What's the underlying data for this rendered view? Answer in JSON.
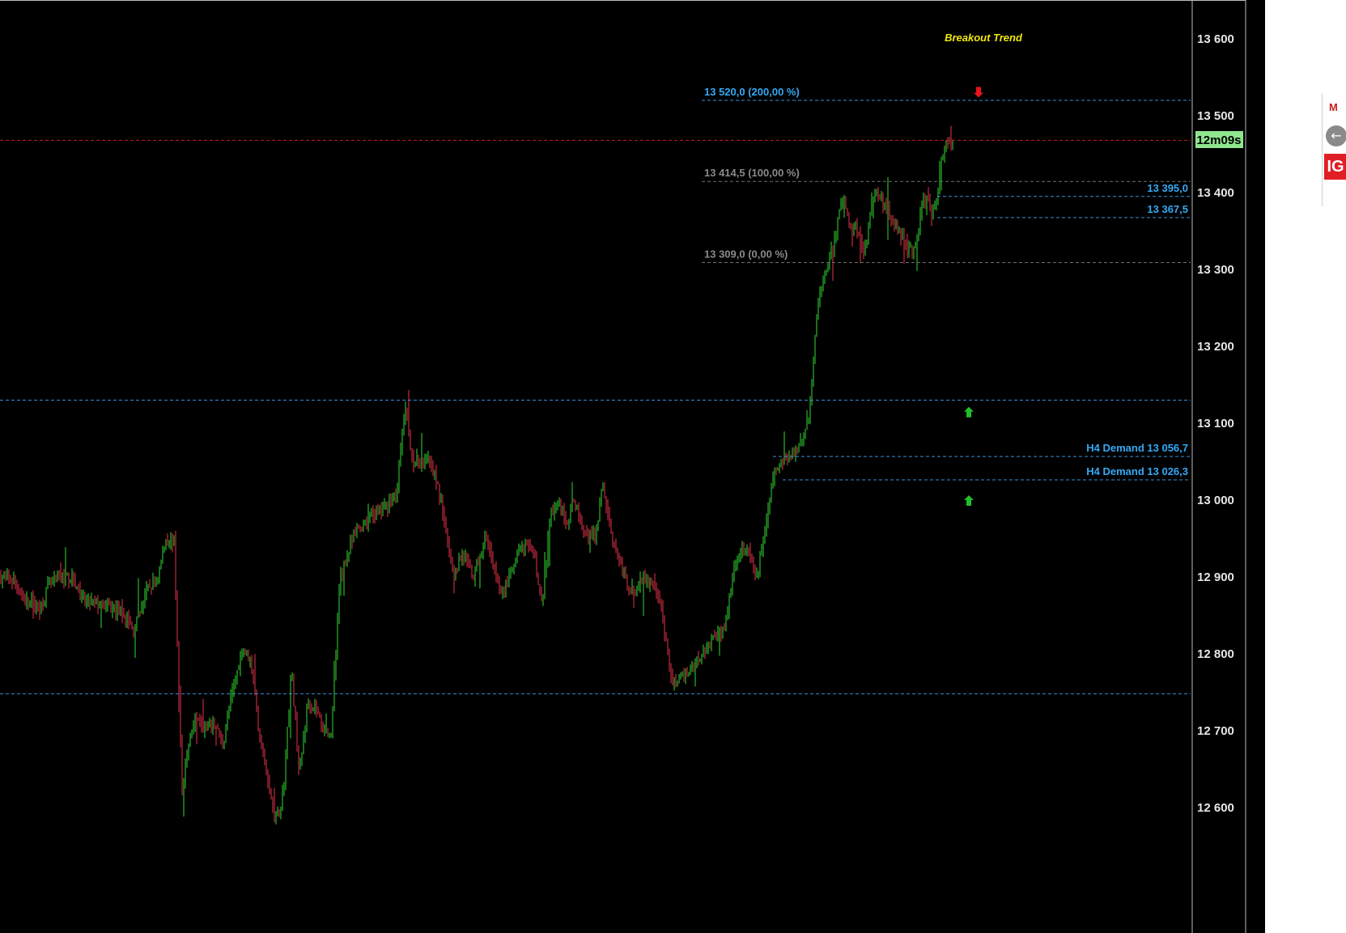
{
  "chart_data": {
    "type": "candlestick",
    "title": "Breakout Trend",
    "timer": "12m09s",
    "y_ticks": [
      {
        "value": 13600,
        "label": "13 600"
      },
      {
        "value": 13500,
        "label": "13 500"
      },
      {
        "value": 13400,
        "label": "13 400"
      },
      {
        "value": 13300,
        "label": "13 300"
      },
      {
        "value": 13200,
        "label": "13 200"
      },
      {
        "value": 13100,
        "label": "13 100"
      },
      {
        "value": 13000,
        "label": "13 000"
      },
      {
        "value": 12900,
        "label": "12 900"
      },
      {
        "value": 12800,
        "label": "12 800"
      },
      {
        "value": 12700,
        "label": "12 700"
      },
      {
        "value": 12600,
        "label": "12 600"
      }
    ],
    "ylim": [
      12505,
      13650
    ],
    "current_price": 13468,
    "levels": [
      {
        "value": 13520.0,
        "label": "13 520,0 (200,00 %)",
        "kind": "fib"
      },
      {
        "value": 13414.5,
        "label": "13 414,5 (100,00 %)",
        "kind": "fib-grey"
      },
      {
        "value": 13309.0,
        "label": "13 309,0 (0,00 %)",
        "kind": "fib-grey"
      },
      {
        "value": 13395.0,
        "label": "13 395,0",
        "kind": "level"
      },
      {
        "value": 13367.5,
        "label": "13 367,5",
        "kind": "level"
      },
      {
        "value": 13056.7,
        "label": "H4 Demand 13 056,7",
        "kind": "level"
      },
      {
        "value": 13026.3,
        "label": "H4 Demand 13 026,3",
        "kind": "level"
      },
      {
        "value": 13130,
        "label": "",
        "kind": "line"
      },
      {
        "value": 12748,
        "label": "",
        "kind": "line"
      }
    ],
    "arrows": [
      {
        "direction": "down",
        "color": "#e8141c",
        "value": 13530
      },
      {
        "direction": "up",
        "color": "#1fbf2a",
        "value": 13115
      },
      {
        "direction": "up",
        "color": "#1fbf2a",
        "value": 13000
      }
    ],
    "anchors": [
      [
        0,
        12900
      ],
      [
        18,
        12895
      ],
      [
        30,
        12870
      ],
      [
        50,
        12860
      ],
      [
        60,
        12890
      ],
      [
        75,
        12900
      ],
      [
        90,
        12900
      ],
      [
        100,
        12870
      ],
      [
        120,
        12865
      ],
      [
        150,
        12855
      ],
      [
        165,
        12830
      ],
      [
        180,
        12880
      ],
      [
        195,
        12900
      ],
      [
        205,
        12950
      ],
      [
        215,
        12945
      ],
      [
        225,
        12620
      ],
      [
        235,
        12700
      ],
      [
        245,
        12720
      ],
      [
        255,
        12700
      ],
      [
        265,
        12710
      ],
      [
        275,
        12680
      ],
      [
        285,
        12740
      ],
      [
        300,
        12810
      ],
      [
        310,
        12790
      ],
      [
        320,
        12700
      ],
      [
        330,
        12640
      ],
      [
        340,
        12580
      ],
      [
        350,
        12620
      ],
      [
        360,
        12780
      ],
      [
        370,
        12640
      ],
      [
        380,
        12740
      ],
      [
        390,
        12730
      ],
      [
        400,
        12700
      ],
      [
        410,
        12700
      ],
      [
        420,
        12900
      ],
      [
        440,
        12960
      ],
      [
        460,
        12980
      ],
      [
        475,
        12990
      ],
      [
        490,
        13010
      ],
      [
        500,
        13120
      ],
      [
        510,
        13050
      ],
      [
        520,
        13050
      ],
      [
        530,
        13060
      ],
      [
        545,
        13000
      ],
      [
        560,
        12900
      ],
      [
        570,
        12930
      ],
      [
        585,
        12900
      ],
      [
        600,
        12950
      ],
      [
        610,
        12910
      ],
      [
        620,
        12880
      ],
      [
        630,
        12900
      ],
      [
        645,
        12940
      ],
      [
        660,
        12930
      ],
      [
        670,
        12860
      ],
      [
        680,
        12980
      ],
      [
        690,
        13000
      ],
      [
        700,
        12970
      ],
      [
        710,
        13000
      ],
      [
        720,
        12960
      ],
      [
        735,
        12950
      ],
      [
        745,
        13020
      ],
      [
        755,
        12960
      ],
      [
        765,
        12920
      ],
      [
        775,
        12890
      ],
      [
        785,
        12880
      ],
      [
        795,
        12900
      ],
      [
        805,
        12890
      ],
      [
        815,
        12870
      ],
      [
        822,
        12820
      ],
      [
        830,
        12760
      ],
      [
        845,
        12770
      ],
      [
        860,
        12790
      ],
      [
        880,
        12820
      ],
      [
        895,
        12830
      ],
      [
        905,
        12900
      ],
      [
        915,
        12940
      ],
      [
        925,
        12930
      ],
      [
        935,
        12900
      ],
      [
        945,
        12960
      ],
      [
        955,
        13030
      ],
      [
        965,
        13050
      ],
      [
        980,
        13060
      ],
      [
        990,
        13080
      ],
      [
        1000,
        13110
      ],
      [
        1006,
        13200
      ],
      [
        1010,
        13250
      ],
      [
        1020,
        13300
      ],
      [
        1030,
        13330
      ],
      [
        1040,
        13390
      ],
      [
        1050,
        13360
      ],
      [
        1060,
        13350
      ],
      [
        1068,
        13320
      ],
      [
        1080,
        13400
      ],
      [
        1090,
        13390
      ],
      [
        1100,
        13370
      ],
      [
        1110,
        13350
      ],
      [
        1120,
        13330
      ],
      [
        1130,
        13320
      ],
      [
        1138,
        13380
      ],
      [
        1145,
        13390
      ],
      [
        1152,
        13370
      ],
      [
        1158,
        13400
      ],
      [
        1162,
        13440
      ],
      [
        1170,
        13465
      ],
      [
        1177,
        13470
      ]
    ]
  }
}
